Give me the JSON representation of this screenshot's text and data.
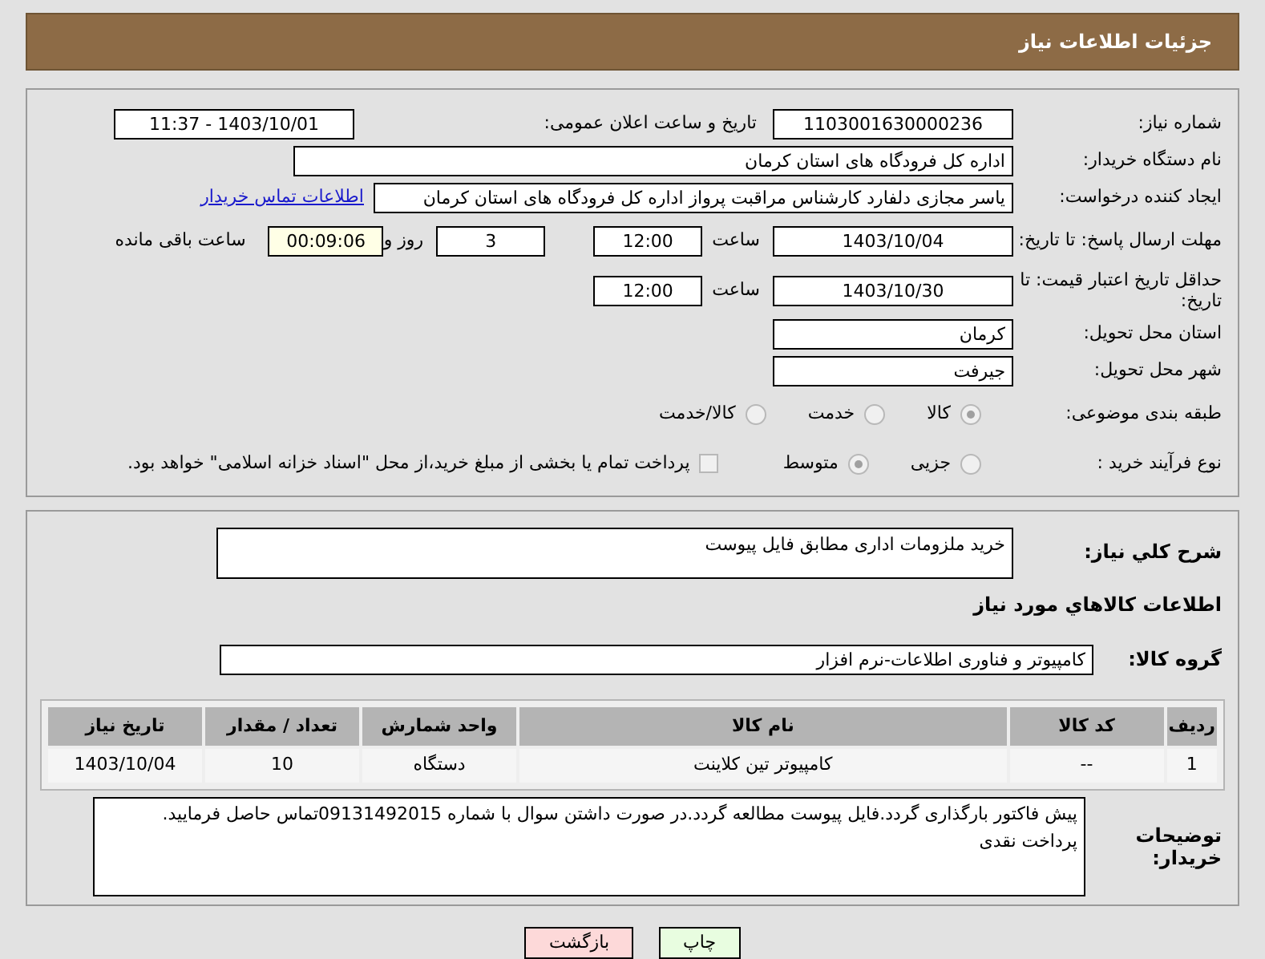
{
  "header": {
    "title": "جزئیات اطلاعات نیاز"
  },
  "rows": [
    {
      "label": "شماره نیاز:",
      "items": [
        {
          "kind": "date_field",
          "value": "1103001630000236"
        },
        {
          "kind": "label",
          "text": "تاریخ و ساعت اعلان عمومی:"
        },
        {
          "kind": "date_field",
          "value": "1403/10/01 - 11:37"
        }
      ]
    },
    {
      "label": "نام دستگاه خریدار:",
      "items": [
        {
          "kind": "wide_field",
          "value": "اداره کل فرودگاه های استان کرمان"
        }
      ]
    },
    {
      "label": "ایجاد کننده درخواست:",
      "items": [
        {
          "kind": "creator_field",
          "value": "یاسر مجازی دلفارد کارشناس مراقبت پرواز اداره کل فرودگاه های استان کرمان"
        },
        {
          "kind": "link",
          "text": "اطلاعات تماس خریدار"
        }
      ]
    },
    {
      "label": "مهلت ارسال پاسخ: تا تاریخ:",
      "items": [
        {
          "kind": "date_field",
          "value": "1403/10/04"
        },
        {
          "kind": "text",
          "text": "ساعت"
        },
        {
          "kind": "time_field",
          "value": "12:00"
        },
        {
          "kind": "time_field",
          "value": "3"
        },
        {
          "kind": "text",
          "text": "روز و"
        },
        {
          "kind": "timer_field",
          "value": "00:09:06"
        },
        {
          "kind": "text",
          "text": "ساعت باقی مانده"
        }
      ]
    },
    {
      "label": "حداقل تاریخ اعتبار قیمت: تا تاریخ:",
      "items": [
        {
          "kind": "date_field",
          "value": "1403/10/30"
        },
        {
          "kind": "text",
          "text": "ساعت"
        },
        {
          "kind": "time_field",
          "value": "12:00"
        }
      ]
    },
    {
      "label": "استان محل تحویل:",
      "items": [
        {
          "kind": "date_field",
          "value": "کرمان"
        }
      ]
    },
    {
      "label": "شهر محل تحویل:",
      "items": [
        {
          "kind": "date_field",
          "value": "جیرفت"
        }
      ]
    },
    {
      "label": "طبقه بندی موضوعی:",
      "items": [
        {
          "kind": "radio",
          "text": "کالا",
          "selected": true
        },
        {
          "kind": "radio",
          "text": "خدمت",
          "selected": false
        },
        {
          "kind": "radio",
          "text": "کالا/خدمت",
          "selected": false
        }
      ]
    },
    {
      "label": "نوع فرآیند خرید :",
      "items": [
        {
          "kind": "radio",
          "text": "جزیی",
          "selected": false
        },
        {
          "kind": "radio",
          "text": "متوسط",
          "selected": true
        },
        {
          "kind": "checkbox",
          "text": "پرداخت تمام یا بخشی از مبلغ خرید،از محل \"اسناد خزانه اسلامی\" خواهد بود.",
          "checked": false
        }
      ]
    }
  ],
  "description": {
    "label": "شرح کلي نياز:",
    "value": "خرید ملزومات اداری مطابق فایل پیوست"
  },
  "goods_heading": "اطلاعات كالاهاي مورد نياز",
  "goods_group": {
    "label": "گروه کالا:",
    "value": "کامپیوتر و فناوری اطلاعات-نرم افزار"
  },
  "table": {
    "columns": [
      "ردیف",
      "کد کالا",
      "نام کالا",
      "واحد شمارش",
      "تعداد / مقدار",
      "تاریخ نیاز"
    ],
    "rows": [
      [
        "1",
        "--",
        "کامپیوتر تین کلاینت",
        "دستگاه",
        "10",
        "1403/10/04"
      ]
    ]
  },
  "buyer_notes": {
    "label": "توضیحات خریدار:",
    "lines": [
      "پیش فاکتور بارگذاری گردد.فایل پیوست مطالعه گردد.در صورت داشتن سوال با شماره 09131492015تماس حاصل فرمایید.",
      "پرداخت نقدی"
    ]
  },
  "buttons": [
    {
      "kind": "print",
      "label": "چاپ"
    },
    {
      "kind": "back",
      "label": "بازگشت"
    }
  ]
}
